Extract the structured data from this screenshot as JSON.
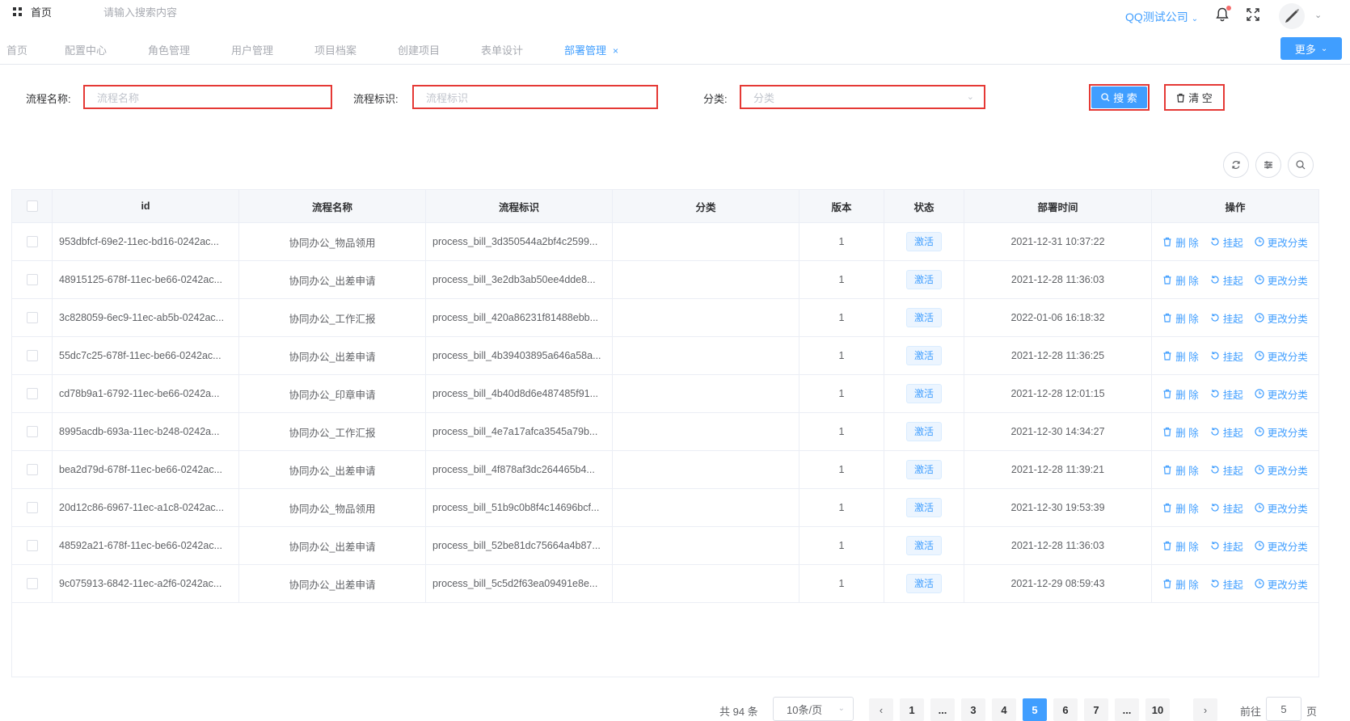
{
  "topbar": {
    "home_label": "首页",
    "search_placeholder": "请输入搜索内容",
    "company": "QQ测试公司"
  },
  "tags": [
    {
      "label": "首页",
      "active": false
    },
    {
      "label": "配置中心",
      "active": false
    },
    {
      "label": "角色管理",
      "active": false
    },
    {
      "label": "用户管理",
      "active": false
    },
    {
      "label": "项目档案",
      "active": false
    },
    {
      "label": "创建项目",
      "active": false
    },
    {
      "label": "表单设计",
      "active": false
    },
    {
      "label": "部署管理",
      "active": true,
      "close": "×"
    }
  ],
  "more_label": "更多",
  "filters": {
    "name_label": "流程名称:",
    "name_placeholder": "流程名称",
    "key_label": "流程标识:",
    "key_placeholder": "流程标识",
    "category_label": "分类:",
    "category_placeholder": "分类",
    "search_label": "搜 索",
    "clear_label": "清 空"
  },
  "table": {
    "headers": [
      "id",
      "流程名称",
      "流程标识",
      "分类",
      "版本",
      "状态",
      "部署时间",
      "操作"
    ],
    "ops": [
      "删 除",
      "挂起",
      "更改分类"
    ],
    "rows": [
      {
        "id": "953dbfcf-69e2-11ec-bd16-0242ac...",
        "name": "协同办公_物品领用",
        "key": "process_bill_3d350544a2bf4c2599...",
        "category": "",
        "version": "1",
        "status": "激活",
        "time": "2021-12-31 10:37:22"
      },
      {
        "id": "48915125-678f-11ec-be66-0242ac...",
        "name": "协同办公_出差申请",
        "key": "process_bill_3e2db3ab50ee4dde8...",
        "category": "",
        "version": "1",
        "status": "激活",
        "time": "2021-12-28 11:36:03"
      },
      {
        "id": "3c828059-6ec9-11ec-ab5b-0242ac...",
        "name": "协同办公_工作汇报",
        "key": "process_bill_420a86231f81488ebb...",
        "category": "",
        "version": "1",
        "status": "激活",
        "time": "2022-01-06 16:18:32"
      },
      {
        "id": "55dc7c25-678f-11ec-be66-0242ac...",
        "name": "协同办公_出差申请",
        "key": "process_bill_4b39403895a646a58a...",
        "category": "",
        "version": "1",
        "status": "激活",
        "time": "2021-12-28 11:36:25"
      },
      {
        "id": "cd78b9a1-6792-11ec-be66-0242a...",
        "name": "协同办公_印章申请",
        "key": "process_bill_4b40d8d6e487485f91...",
        "category": "",
        "version": "1",
        "status": "激活",
        "time": "2021-12-28 12:01:15"
      },
      {
        "id": "8995acdb-693a-11ec-b248-0242a...",
        "name": "协同办公_工作汇报",
        "key": "process_bill_4e7a17afca3545a79b...",
        "category": "",
        "version": "1",
        "status": "激活",
        "time": "2021-12-30 14:34:27"
      },
      {
        "id": "bea2d79d-678f-11ec-be66-0242ac...",
        "name": "协同办公_出差申请",
        "key": "process_bill_4f878af3dc264465b4...",
        "category": "",
        "version": "1",
        "status": "激活",
        "time": "2021-12-28 11:39:21"
      },
      {
        "id": "20d12c86-6967-11ec-a1c8-0242ac...",
        "name": "协同办公_物品领用",
        "key": "process_bill_51b9c0b8f4c14696bcf...",
        "category": "",
        "version": "1",
        "status": "激活",
        "time": "2021-12-30 19:53:39"
      },
      {
        "id": "48592a21-678f-11ec-be66-0242ac...",
        "name": "协同办公_出差申请",
        "key": "process_bill_52be81dc75664a4b87...",
        "category": "",
        "version": "1",
        "status": "激活",
        "time": "2021-12-28 11:36:03"
      },
      {
        "id": "9c075913-6842-11ec-a2f6-0242ac...",
        "name": "协同办公_出差申请",
        "key": "process_bill_5c5d2f63ea09491e8e...",
        "category": "",
        "version": "1",
        "status": "激活",
        "time": "2021-12-29 08:59:43"
      }
    ]
  },
  "pagination": {
    "total": "共 94 条",
    "page_size": "10条/页",
    "pages": [
      "1",
      "...",
      "3",
      "4",
      "5",
      "6",
      "7",
      "...",
      "10"
    ],
    "current": "5",
    "goto_prefix": "前往",
    "goto_value": "5",
    "goto_suffix": "页"
  },
  "colors": {
    "primary": "#409eff",
    "highlight_border": "#e53935"
  }
}
